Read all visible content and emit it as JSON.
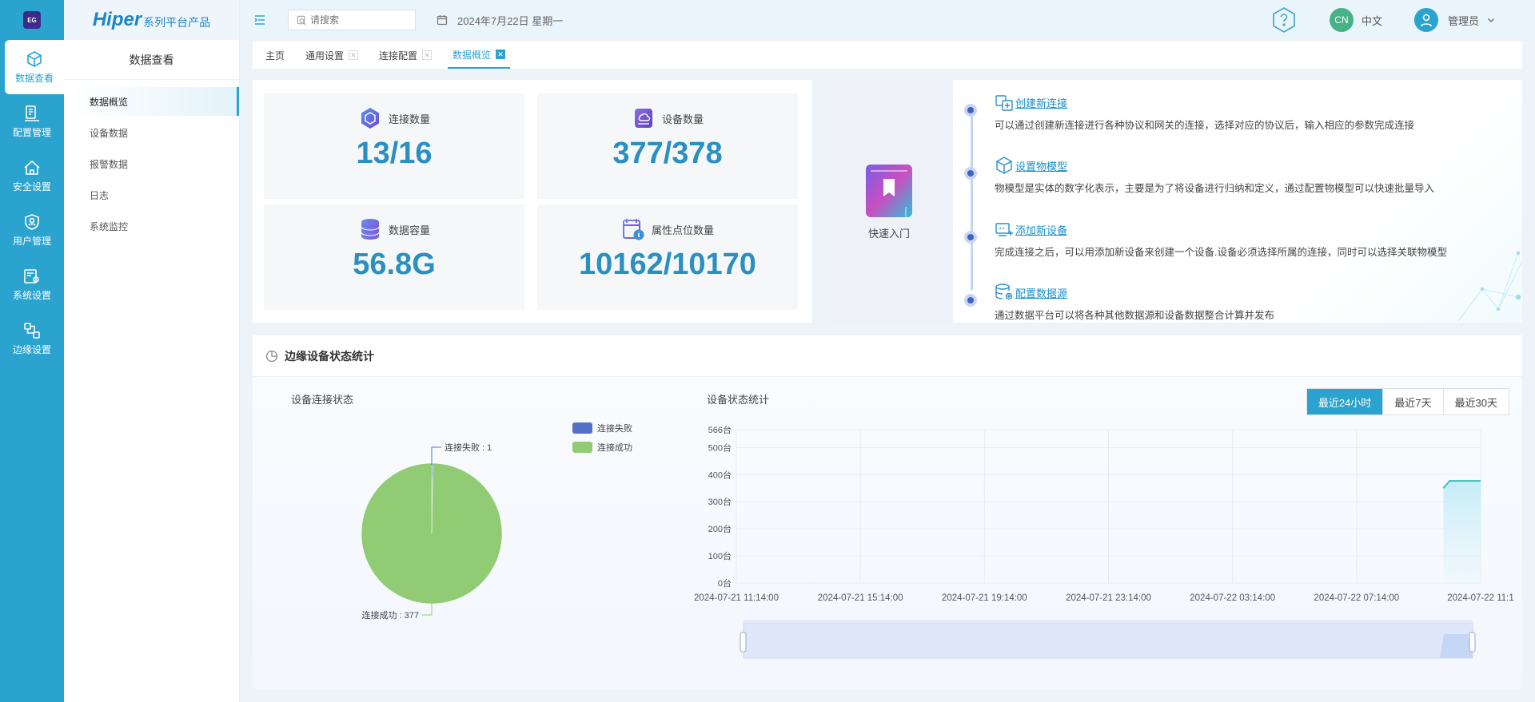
{
  "app": {
    "logo_text": "EG",
    "brand_main": "Hiper",
    "brand_sub": "系列平台产品"
  },
  "rail": [
    {
      "label": "数据查看",
      "icon": "cube-icon",
      "active": true
    },
    {
      "label": "配置管理",
      "icon": "config-icon",
      "active": false
    },
    {
      "label": "安全设置",
      "icon": "security-icon",
      "active": false
    },
    {
      "label": "用户管理",
      "icon": "user-shield-icon",
      "active": false
    },
    {
      "label": "系统设置",
      "icon": "system-settings-icon",
      "active": false
    },
    {
      "label": "边缘设置",
      "icon": "edge-icon",
      "active": false
    }
  ],
  "sidebar": {
    "title": "数据查看",
    "items": [
      {
        "label": "数据概览",
        "active": true
      },
      {
        "label": "设备数据",
        "active": false
      },
      {
        "label": "报警数据",
        "active": false
      },
      {
        "label": "日志",
        "active": false
      },
      {
        "label": "系统监控",
        "active": false
      }
    ]
  },
  "header": {
    "search_placeholder": "请搜索",
    "date": "2024年7月22日 星期一",
    "lang_badge": "CN",
    "lang_label": "中文",
    "user_name": "管理员"
  },
  "tabs": [
    {
      "label": "主页",
      "closable": false,
      "active": false
    },
    {
      "label": "通用设置",
      "closable": true,
      "active": false
    },
    {
      "label": "连接配置",
      "closable": true,
      "active": false
    },
    {
      "label": "数据概览",
      "closable": true,
      "active": true
    }
  ],
  "stats": [
    {
      "label": "连接数量",
      "value": "13/16",
      "icon": "connection-cube-icon"
    },
    {
      "label": "设备数量",
      "value": "377/378",
      "icon": "device-cloud-icon"
    },
    {
      "label": "数据容量",
      "value": "56.8G",
      "icon": "database-icon"
    },
    {
      "label": "属性点位数量",
      "value": "10162/10170",
      "icon": "calendar-info-icon"
    }
  ],
  "quick": {
    "label": "快速入门",
    "icon": "book-icon",
    "steps": [
      {
        "title": "创建新连接",
        "icon": "link-create-icon",
        "desc": "可以通过创建新连接进行各种协议和网关的连接，选择对应的协议后，输入相应的参数完成连接"
      },
      {
        "title": "设置物模型",
        "icon": "model-cube-icon",
        "desc": "物模型是实体的数字化表示，主要是为了将设备进行归纳和定义，通过配置物模型可以快速批量导入"
      },
      {
        "title": "添加新设备",
        "icon": "device-add-icon",
        "desc": "完成连接之后，可以用添加新设备来创建一个设备.设备必须选择所属的连接，同时可以选择关联物模型"
      },
      {
        "title": "配置数据源",
        "icon": "datasource-gear-icon",
        "desc": "通过数据平台可以将各种其他数据源和设备数据整合计算并发布"
      }
    ]
  },
  "bottom": {
    "title": "边缘设备状态统计",
    "pie_title": "设备连接状态",
    "line_title": "设备状态统计",
    "ranges": [
      {
        "label": "最近24小时",
        "active": true
      },
      {
        "label": "最近7天",
        "active": false
      },
      {
        "label": "最近30天",
        "active": false
      }
    ]
  },
  "colors": {
    "fail": "#5470c6",
    "success": "#91cc75",
    "line": "#3dbfb3",
    "accent": "#2aa3cf"
  },
  "chart_data": [
    {
      "type": "pie",
      "title": "设备连接状态",
      "series": [
        {
          "name": "连接失败",
          "value": 1
        },
        {
          "name": "连接成功",
          "value": 377
        }
      ],
      "labels": [
        "连接失败 :  1",
        "连接成功 :  377"
      ],
      "legend": "top-right"
    },
    {
      "type": "area",
      "title": "设备状态统计",
      "x_ticks": [
        "2024-07-21 11:14:00",
        "2024-07-21 15:14:00",
        "2024-07-21 19:14:00",
        "2024-07-21 23:14:00",
        "2024-07-22 03:14:00",
        "2024-07-22 07:14:00",
        "2024-07-22 11:1"
      ],
      "y_ticks": [
        "0台",
        "100台",
        "200台",
        "300台",
        "400台",
        "500台",
        "566台"
      ],
      "ylim": [
        0,
        566
      ],
      "x_range_hours": [
        0,
        24
      ],
      "points": [
        [
          22.8,
          350
        ],
        [
          23.0,
          377
        ],
        [
          24.0,
          377
        ]
      ],
      "grid": true
    }
  ]
}
